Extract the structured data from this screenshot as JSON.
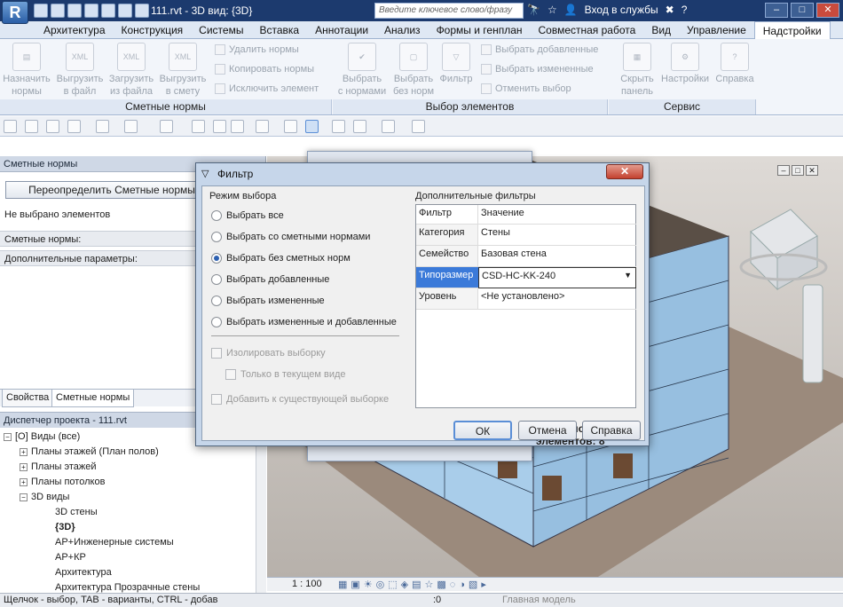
{
  "app": {
    "logo": "R",
    "file_title": "111.rvt - 3D вид: {3D}",
    "search_placeholder": "Введите ключевое слово/фразу",
    "login": "Вход в службы",
    "help": "?"
  },
  "tabs": [
    "Архитектура",
    "Конструкция",
    "Системы",
    "Вставка",
    "Аннотации",
    "Анализ",
    "Формы и генплан",
    "Совместная работа",
    "Вид",
    "Управление",
    "Надстройки"
  ],
  "ribbon": {
    "estimate": {
      "assign": "Назначить\nнормы",
      "export_file": "Выгрузить\nв файл",
      "load_file": "Загрузить\nиз файла",
      "export_estimate": "Выгрузить\nв смету",
      "delete": "Удалить нормы",
      "copy": "Копировать нормы",
      "exclude": "Исключить элемент",
      "panel": "Сметные нормы"
    },
    "select": {
      "with": "Выбрать\nс нормами",
      "without": "Выбрать\nбез норм",
      "filter": "Фильтр",
      "added": "Выбрать добавленные",
      "changed": "Выбрать измененные",
      "cancel": "Отменить выбор",
      "panel": "Выбор элементов"
    },
    "service": {
      "hide": "Скрыть\nпанель",
      "settings": "Настройки",
      "help": "Справка",
      "panel": "Сервис"
    }
  },
  "left": {
    "header": "Сметные нормы",
    "override": "Переопределить Сметные нормы",
    "no_sel": "Не выбрано элементов",
    "norms": "Сметные нормы:",
    "extra": "Дополнительные параметры:",
    "tab_props": "Свойства",
    "tab_norms": "Сметные нормы",
    "pm_header": "Диспетчер проекта - 111.rvt",
    "tree": [
      "Виды (все)",
      "Планы этажей (План полов)",
      "Планы этажей",
      "Планы потолков",
      "3D виды",
      "3D стены",
      "{3D}",
      "АР+Инженерные системы",
      "АР+КР",
      "Архитектура",
      "Архитектура Прозрачные стены"
    ]
  },
  "dialog": {
    "title": "Фильтр",
    "mode_title": "Режим выбора",
    "modes": [
      "Выбрать все",
      "Выбрать со сметными нормами",
      "Выбрать без сметных норм",
      "Выбрать добавленные",
      "Выбрать измененные",
      "Выбрать измененные и добавленные"
    ],
    "isolate": "Изолировать выборку",
    "current_view": "Только в текущем виде",
    "add_existing": "Добавить к существующей выборке",
    "filters_title": "Дополнительные фильтры",
    "col_filter": "Фильтр",
    "col_value": "Значение",
    "rows": [
      [
        "Категория",
        "Стены"
      ],
      [
        "Семейство",
        "Базовая стена"
      ],
      [
        "Типоразмер",
        "CSD-HC-KK-240"
      ],
      [
        "Уровень",
        "<Не установлено>"
      ]
    ],
    "selected": "Выбрано элементов: 8",
    "ok": "ОК",
    "cancel": "Отмена",
    "help": "Справка"
  },
  "viewbar": {
    "scale": "1 : 100"
  },
  "status": {
    "hint": "Щелчок - выбор, TAB - варианты, CTRL - добав",
    "zero": ":0",
    "model": "Главная модель"
  },
  "colors": {
    "title": "#1c3a6e",
    "wall": "#a9cdea",
    "accent": "#2c5fb0"
  }
}
